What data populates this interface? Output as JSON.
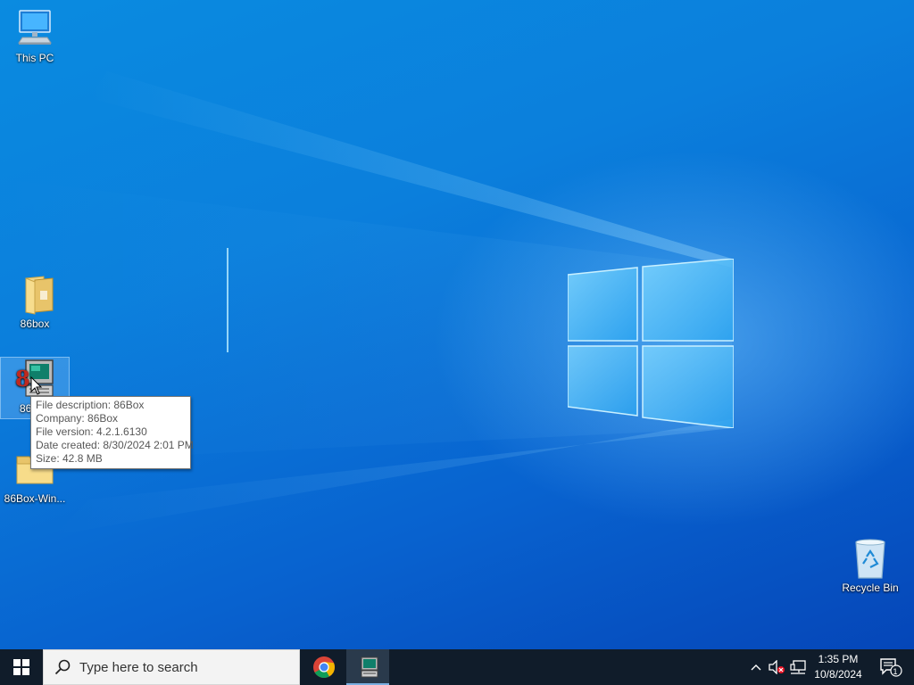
{
  "desktop": {
    "icons": [
      {
        "label": "This PC",
        "icon": "this-pc-icon"
      },
      {
        "label": "86box",
        "icon": "folder-icon"
      },
      {
        "label": "86Box",
        "icon": "86box-app-icon"
      },
      {
        "label": "86Box-Win...",
        "icon": "folder-icon"
      },
      {
        "label": "Recycle Bin",
        "icon": "recycle-bin-icon"
      }
    ]
  },
  "tooltip": {
    "description": "File description: 86Box",
    "company": "Company: 86Box",
    "version": "File version: 4.2.1.6130",
    "date_created": "Date created: 8/30/2024 2:01 PM",
    "size": "Size: 42.8 MB"
  },
  "taskbar": {
    "search_placeholder": "Type here to search",
    "apps": [
      {
        "name": "Google Chrome",
        "icon": "chrome-icon"
      },
      {
        "name": "86Box",
        "icon": "86box-app-icon",
        "active": true
      }
    ],
    "tray": {
      "time": "1:35 PM",
      "date": "10/8/2024",
      "notification_count": "1"
    }
  },
  "colors": {
    "desktop_accent": "#0b7fdc",
    "taskbar": "#101c2a",
    "tooltip_bg": "#ffffff",
    "tooltip_text": "#575757"
  }
}
